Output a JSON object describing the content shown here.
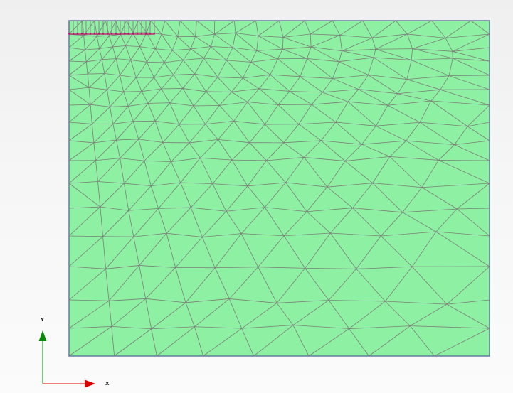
{
  "axes": {
    "x_label": "X",
    "y_label": "Y",
    "x_color": "#dd0000",
    "y_color": "#0a8a0a"
  },
  "colors": {
    "background_top": "#efefef",
    "background_bottom": "#fbfbfb",
    "domain_fill": "#8ef0a2",
    "domain_border": "#3a66c8",
    "mesh_line": "#7a7f7a",
    "load_color": "#c0106c"
  },
  "icons": {
    "distributed_load": "distributed-load-icon",
    "x_axis_arrow": "arrow-right-icon",
    "y_axis_arrow": "arrow-up-icon"
  }
}
